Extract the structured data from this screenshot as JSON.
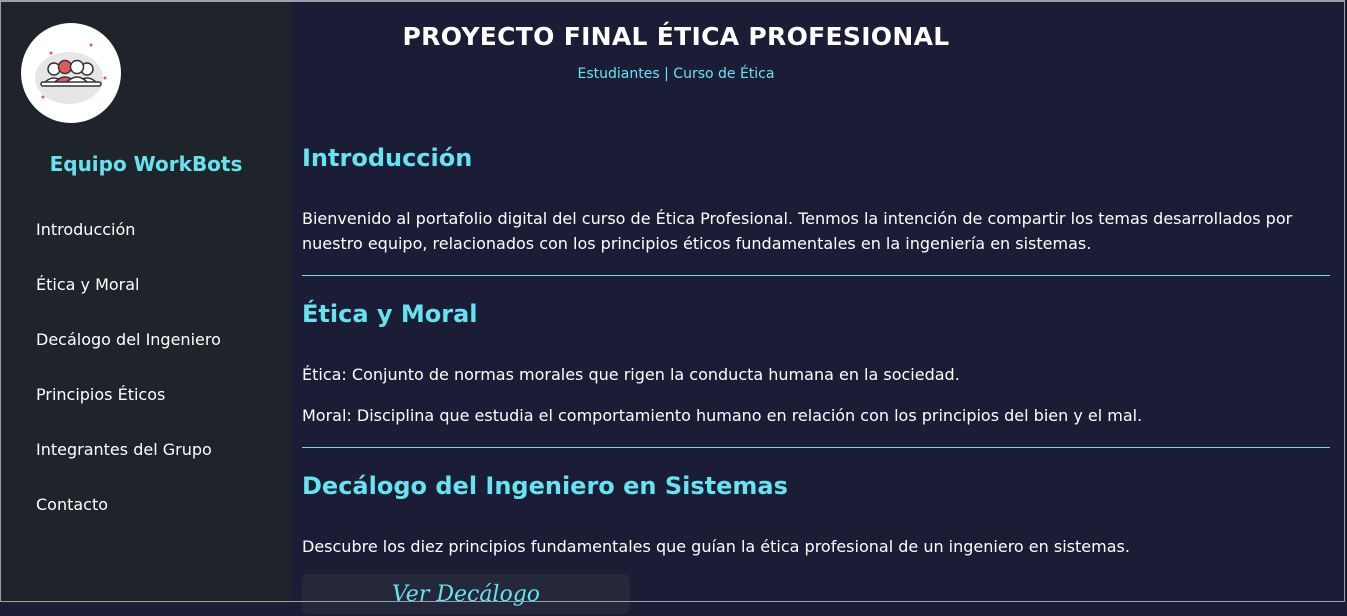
{
  "sidebar": {
    "logo_icon": "team-people-icon",
    "team_name": "Equipo WorkBots",
    "items": [
      {
        "label": "Introducción"
      },
      {
        "label": "Ética y Moral"
      },
      {
        "label": "Decálogo del Ingeniero"
      },
      {
        "label": "Principios Éticos"
      },
      {
        "label": "Integrantes del Grupo"
      },
      {
        "label": "Contacto"
      }
    ]
  },
  "header": {
    "title": "PROYECTO FINAL ÉTICA PROFESIONAL",
    "subtitle_left": "Estudiantes",
    "subtitle_sep": " | ",
    "subtitle_right": "Curso de Ética"
  },
  "sections": {
    "intro": {
      "heading": "Introducción",
      "text": "Bienvenido al portafolio digital del curso de Ética Profesional. Tenmos la intención de compartir los temas desarrollados por nuestro equipo, relacionados con los principios éticos fundamentales en la ingeniería en sistemas."
    },
    "etica": {
      "heading": "Ética y Moral",
      "text1": "Ética: Conjunto de normas morales que rigen la conducta humana en la sociedad.",
      "text2": "Moral: Disciplina que estudia el comportamiento humano en relación con los principios del bien y el mal."
    },
    "decalogo": {
      "heading": "Decálogo del Ingeniero en Sistemas",
      "text": "Descubre los diez principios fundamentales que guían la ética profesional de un ingeniero en sistemas.",
      "button_label": "Ver Decálogo"
    }
  },
  "colors": {
    "background": "#1b1d36",
    "sidebar": "#1f232a",
    "accent": "#66e3f0",
    "text": "#ffffff"
  }
}
